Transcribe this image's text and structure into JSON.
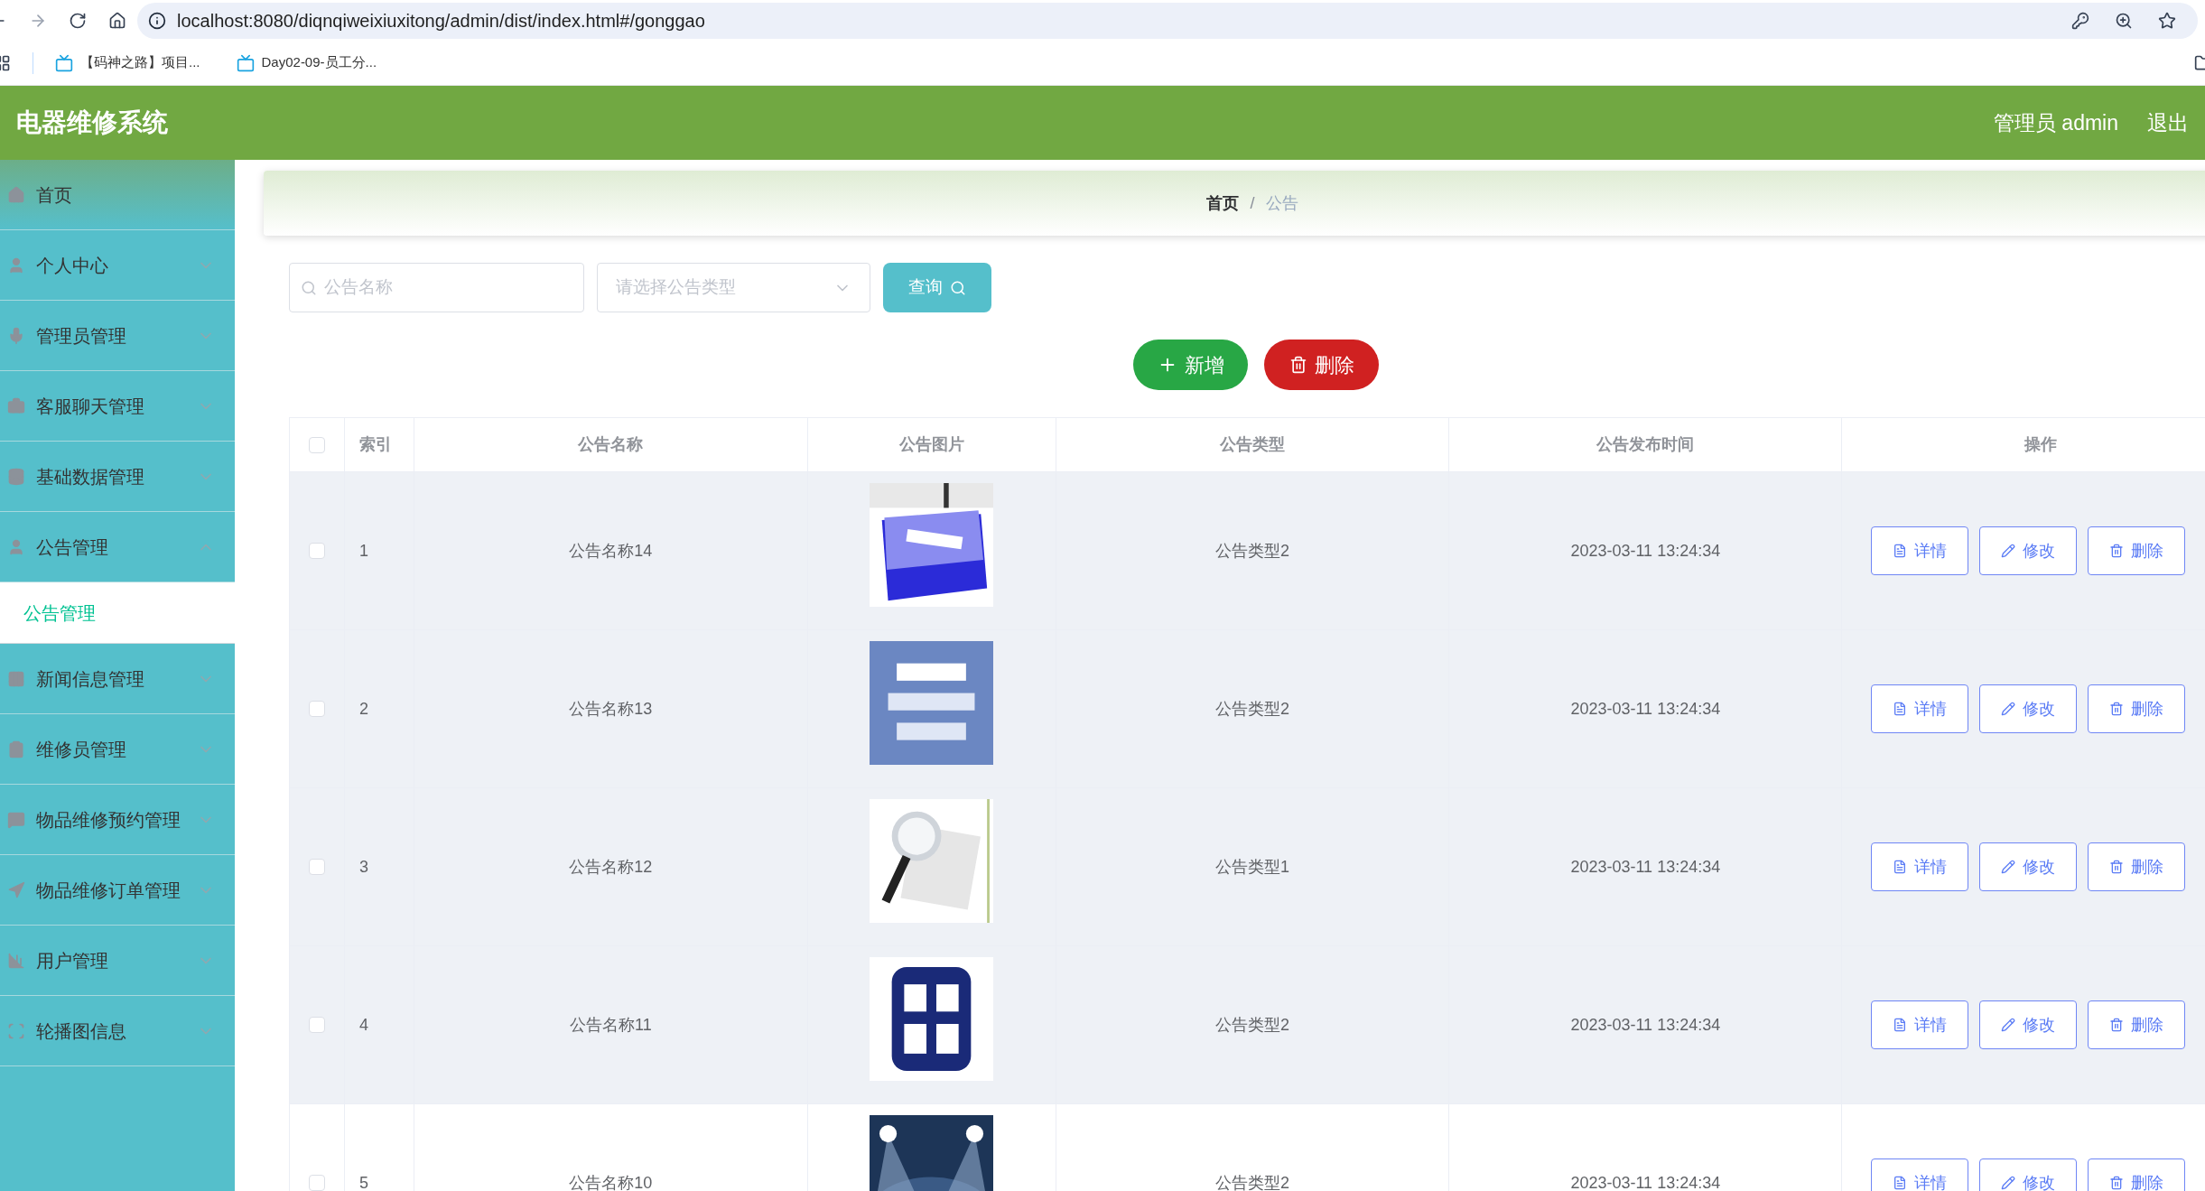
{
  "browser": {
    "url": "localhost:8080/diqnqiweixiuxitong/admin/dist/index.html#/gonggao",
    "bookmarks": [
      "【码神之路】项目...",
      "Day02-09-员工分..."
    ]
  },
  "header": {
    "title": "电器维修系统",
    "user": "管理员 admin",
    "logout": "退出"
  },
  "sidebar": {
    "items": [
      {
        "label": "首页",
        "kind": "link"
      },
      {
        "label": "个人中心",
        "kind": "menu",
        "expanded": false
      },
      {
        "label": "管理员管理",
        "kind": "menu",
        "expanded": false
      },
      {
        "label": "客服聊天管理",
        "kind": "menu",
        "expanded": false
      },
      {
        "label": "基础数据管理",
        "kind": "menu",
        "expanded": false
      },
      {
        "label": "公告管理",
        "kind": "menu",
        "expanded": true,
        "children": [
          {
            "label": "公告管理",
            "selected": true
          }
        ]
      },
      {
        "label": "新闻信息管理",
        "kind": "menu",
        "expanded": false
      },
      {
        "label": "维修员管理",
        "kind": "menu",
        "expanded": false
      },
      {
        "label": "物品维修预约管理",
        "kind": "menu",
        "expanded": false
      },
      {
        "label": "物品维修订单管理",
        "kind": "menu",
        "expanded": false
      },
      {
        "label": "用户管理",
        "kind": "menu",
        "expanded": false
      },
      {
        "label": "轮播图信息",
        "kind": "menu",
        "expanded": false
      }
    ]
  },
  "breadcrumb": {
    "items": [
      "首页",
      "公告"
    ],
    "separator": "/"
  },
  "search": {
    "name_placeholder": "公告名称",
    "type_placeholder": "请选择公告类型",
    "query": "查询"
  },
  "actions": {
    "add": "新增",
    "delete": "删除"
  },
  "table": {
    "all_checked": false,
    "columns": [
      "索引",
      "公告名称",
      "公告图片",
      "公告类型",
      "公告发布时间",
      "操作"
    ],
    "rows": [
      {
        "checked": false,
        "highlighted": true,
        "index": "1",
        "name": "公告名称14",
        "type": "公告类型2",
        "time": "2023-03-11 13:24:34",
        "buttons": [
          "详情",
          "修改",
          "删除"
        ]
      },
      {
        "checked": false,
        "highlighted": true,
        "index": "2",
        "name": "公告名称13",
        "type": "公告类型2",
        "time": "2023-03-11 13:24:34",
        "buttons": [
          "详情",
          "修改",
          "删除"
        ]
      },
      {
        "checked": false,
        "highlighted": true,
        "index": "3",
        "name": "公告名称12",
        "type": "公告类型1",
        "time": "2023-03-11 13:24:34",
        "buttons": [
          "详情",
          "修改",
          "删除"
        ]
      },
      {
        "checked": false,
        "highlighted": true,
        "index": "4",
        "name": "公告名称11",
        "type": "公告类型2",
        "time": "2023-03-11 13:24:34",
        "buttons": [
          "详情",
          "修改",
          "删除"
        ]
      },
      {
        "checked": false,
        "highlighted": false,
        "index": "5",
        "name": "公告名称10",
        "type": "公告类型2",
        "time": "2023-03-11 13:24:34",
        "buttons": [
          "详情",
          "修改",
          "删除"
        ]
      }
    ]
  }
}
